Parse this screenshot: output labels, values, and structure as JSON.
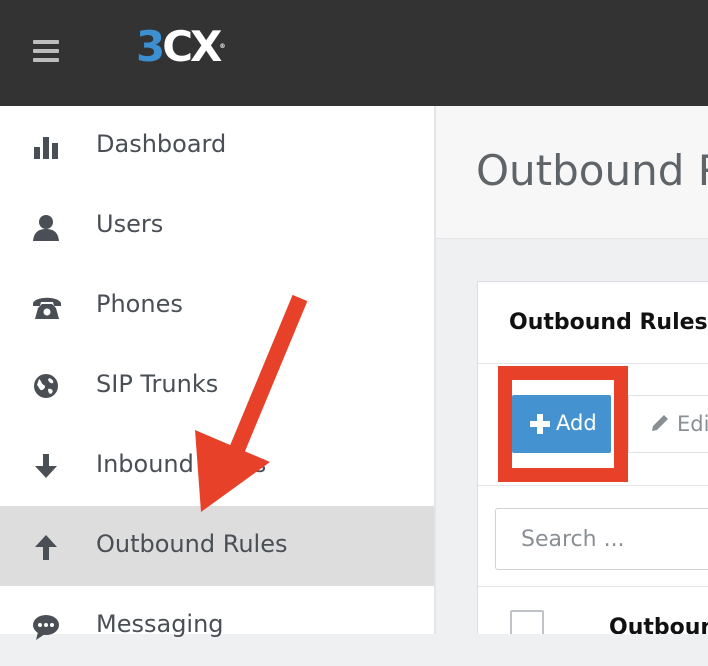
{
  "header": {
    "logo_three": "3",
    "logo_cx": "CX",
    "logo_reg": "®",
    "background": "#333333",
    "logo_color": "#3c8fd1"
  },
  "sidebar": {
    "items": [
      {
        "label": "Dashboard",
        "icon": "bar-chart-icon",
        "active": false
      },
      {
        "label": "Users",
        "icon": "user-icon",
        "active": false
      },
      {
        "label": "Phones",
        "icon": "phone-icon",
        "active": false
      },
      {
        "label": "SIP Trunks",
        "icon": "globe-icon",
        "active": false
      },
      {
        "label": "Inbound Rules",
        "icon": "arrow-down-icon",
        "active": false
      },
      {
        "label": "Outbound Rules",
        "icon": "arrow-up-icon",
        "active": true
      },
      {
        "label": "Messaging",
        "icon": "chat-icon",
        "active": false
      }
    ],
    "active_background": "#dddddd"
  },
  "main": {
    "page_title": "Outbound Rules",
    "panel": {
      "title": "Outbound Rules",
      "add_label": "Add",
      "edit_label": "Edit",
      "search_placeholder": "Search ...",
      "table_header": "Outbound Rules"
    }
  },
  "annotations": {
    "color": "#e8412a",
    "highlight_target": "add-button",
    "arrow_target": "sidebar-item-outbound-rules"
  }
}
